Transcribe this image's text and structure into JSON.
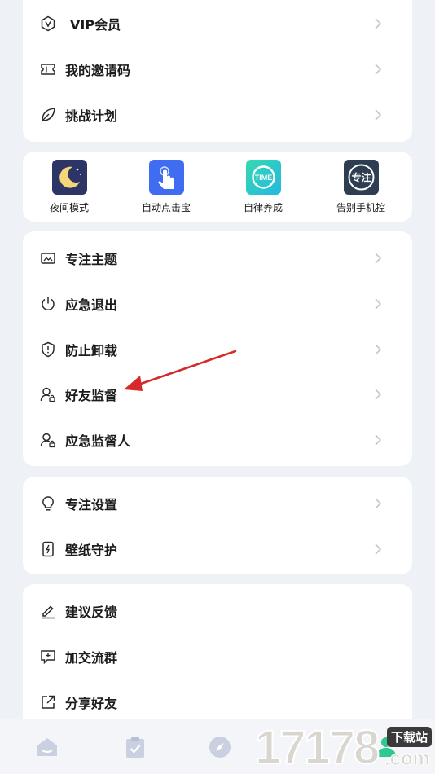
{
  "card_a": {
    "items": [
      {
        "label": "VIP会员",
        "icon": "vip-badge-icon"
      },
      {
        "label": "我的邀请码",
        "icon": "ticket-icon"
      },
      {
        "label": "挑战计划",
        "icon": "leaf-icon"
      }
    ]
  },
  "tools": [
    {
      "label": "夜间模式",
      "icon": "night-mode-icon"
    },
    {
      "label": "自动点击宝",
      "icon": "auto-click-icon"
    },
    {
      "label": "自律养成",
      "icon": "time-icon",
      "icon_text": "TIME"
    },
    {
      "label": "告别手机控",
      "icon": "focus-icon",
      "icon_text": "专注"
    }
  ],
  "card_b": {
    "items": [
      {
        "label": "专注主题",
        "icon": "picture-icon"
      },
      {
        "label": "应急退出",
        "icon": "power-icon"
      },
      {
        "label": "防止卸载",
        "icon": "shield-icon"
      },
      {
        "label": "好友监督",
        "icon": "user-lock-icon"
      },
      {
        "label": "应急监督人",
        "icon": "user-lock-icon"
      }
    ]
  },
  "card_c": {
    "items": [
      {
        "label": "专注设置",
        "icon": "bulb-icon"
      },
      {
        "label": "壁纸守护",
        "icon": "phone-bolt-icon"
      }
    ]
  },
  "card_d": {
    "items": [
      {
        "label": "建议反馈",
        "icon": "pencil-icon"
      },
      {
        "label": "加交流群",
        "icon": "chat-plus-icon"
      },
      {
        "label": "分享好友",
        "icon": "share-icon"
      }
    ]
  },
  "tabbar": {
    "tabs": [
      {
        "icon": "home-icon"
      },
      {
        "icon": "clipboard-check-icon"
      },
      {
        "icon": "compass-icon"
      },
      {
        "icon": "profile-icon"
      }
    ]
  },
  "watermark": {
    "digits": "17178",
    "badge": "下载站",
    "suffix": ".com"
  },
  "colors": {
    "background": "#eef1f6",
    "card": "#ffffff",
    "text": "#1c1c1e",
    "icon_stroke": "#2a2a2a",
    "chevron": "#c4c7cd",
    "tab_icon": "#c9d1e0",
    "annotation_arrow": "#d42a2a"
  }
}
